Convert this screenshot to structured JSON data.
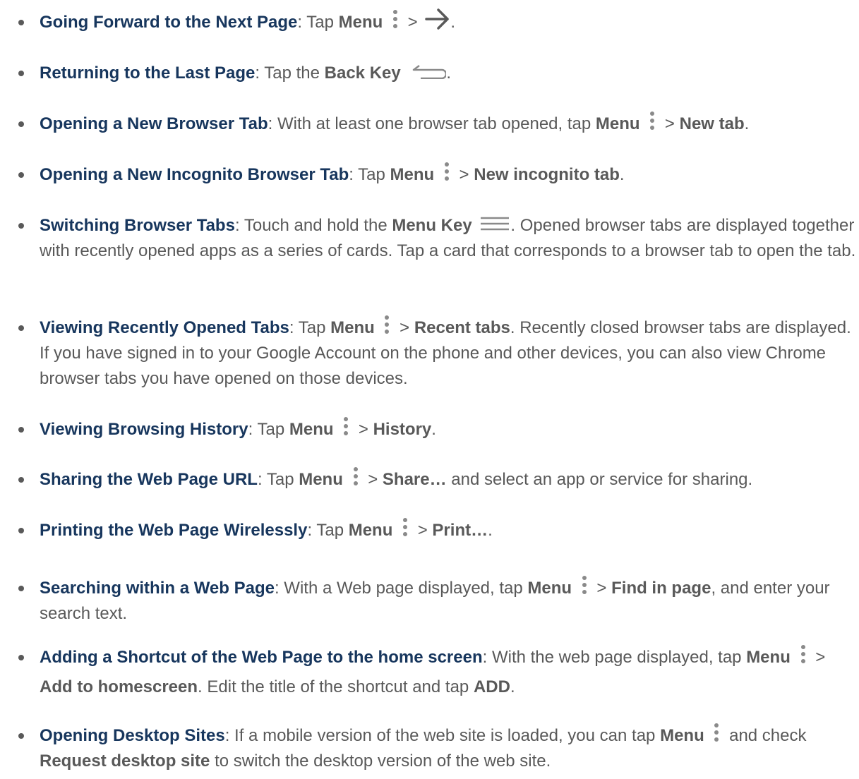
{
  "items": [
    {
      "title": "Going Forward to the Next Page",
      "parts": [
        ": Tap ",
        "Menu",
        " > ",
        "."
      ]
    },
    {
      "title": "Returning to the Last Page",
      "parts": [
        ": Tap the ",
        "Back Key",
        "."
      ]
    },
    {
      "title": "Opening a New Browser Tab",
      "parts": [
        ": With at least one browser tab opened, tap ",
        "Menu",
        " > ",
        "New tab",
        "."
      ]
    },
    {
      "title": "Opening a New Incognito Browser Tab",
      "parts": [
        ": Tap ",
        "Menu",
        " > ",
        "New incognito tab",
        "."
      ]
    },
    {
      "title": "Switching Browser Tabs",
      "parts": [
        ": Touch and hold the ",
        "Menu Key",
        ". Opened browser tabs are displayed together with recently opened apps as a series of cards. Tap a card that corresponds to a browser tab to open the tab."
      ]
    },
    {
      "title": "Viewing Recently Opened Tabs",
      "parts": [
        ": Tap ",
        "Menu",
        " > ",
        "Recent tabs",
        ". Recently closed browser tabs are displayed. If you have signed in to your Google Account on the phone and other devices, you can also view Chrome browser tabs you have opened on those devices."
      ]
    },
    {
      "title": "Viewing Browsing History",
      "parts": [
        ": Tap ",
        "Menu",
        " > ",
        "History",
        "."
      ]
    },
    {
      "title": "Sharing the Web Page URL",
      "parts": [
        ": Tap ",
        "Menu",
        " > ",
        "Share…",
        " and select an app or service for sharing."
      ]
    },
    {
      "title": "Printing the Web Page Wirelessly",
      "parts": [
        ": Tap ",
        "Menu",
        " > ",
        "Print…",
        "."
      ]
    },
    {
      "title": "Searching within a Web Page",
      "parts": [
        ": With a Web page displayed, tap ",
        "Menu",
        " > ",
        "Find in page",
        ", and enter your search text."
      ]
    },
    {
      "title": "Adding a Shortcut of the Web Page to the home screen",
      "parts": [
        ": With the web page displayed, tap ",
        "Menu",
        " > ",
        "Add to homescreen",
        ". Edit the title of the shortcut and tap ",
        "ADD",
        "."
      ]
    },
    {
      "title": "Opening Desktop Sites",
      "parts": [
        ": If a mobile version of the web site is loaded, you can tap ",
        "Menu",
        " and check ",
        "Request desktop site",
        " to switch the desktop version of the web site."
      ]
    }
  ],
  "icons": {
    "menu_dots": "vertical-dots-menu-icon",
    "forward": "forward-arrow-icon",
    "back_key": "back-key-icon",
    "menu_key": "menu-key-icon"
  },
  "colors": {
    "title": "#17365D",
    "body": "#595959",
    "icon": "#8a8a8a"
  }
}
